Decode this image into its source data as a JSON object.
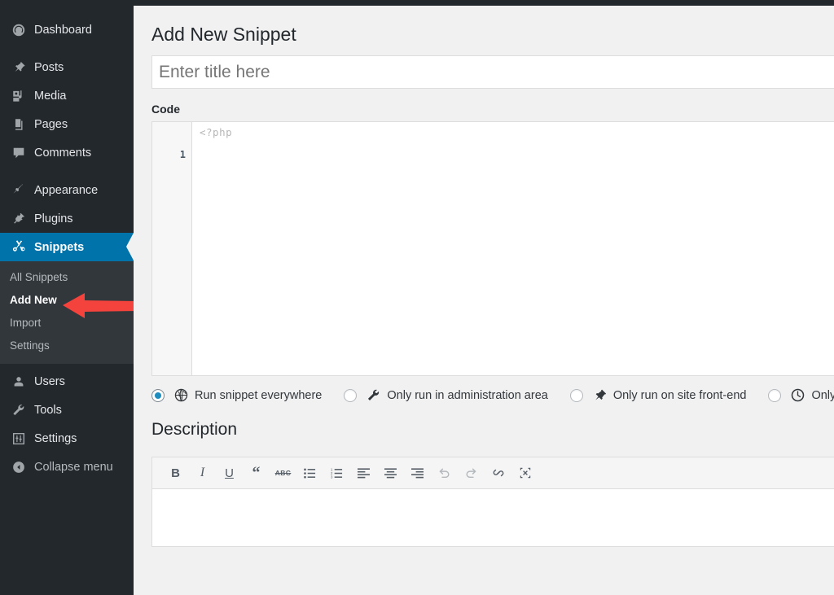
{
  "sidebar": {
    "items": [
      {
        "label": "Dashboard",
        "icon": "dashboard-icon"
      },
      {
        "label": "Posts",
        "icon": "pin-icon"
      },
      {
        "label": "Media",
        "icon": "media-icon"
      },
      {
        "label": "Pages",
        "icon": "pages-icon"
      },
      {
        "label": "Comments",
        "icon": "comment-icon"
      },
      {
        "label": "Appearance",
        "icon": "brush-icon"
      },
      {
        "label": "Plugins",
        "icon": "plug-icon"
      },
      {
        "label": "Snippets",
        "icon": "scissors-icon",
        "active": true
      },
      {
        "label": "Users",
        "icon": "user-icon"
      },
      {
        "label": "Tools",
        "icon": "wrench-icon"
      },
      {
        "label": "Settings",
        "icon": "sliders-icon"
      },
      {
        "label": "Collapse menu",
        "icon": "collapse-arrow-icon"
      }
    ],
    "submenu": [
      {
        "label": "All Snippets",
        "current": false
      },
      {
        "label": "Add New",
        "current": true
      },
      {
        "label": "Import",
        "current": false
      },
      {
        "label": "Settings",
        "current": false
      }
    ],
    "active_color": "#0073aa",
    "background_color": "#23282d",
    "submenu_background_color": "#32373c"
  },
  "annotation": {
    "arrow_color": "#f3433c",
    "points_at": "Add New"
  },
  "main": {
    "page_title": "Add New Snippet",
    "title_input": {
      "value": "",
      "placeholder": "Enter title here"
    },
    "code_section_label": "Code",
    "code_editor": {
      "line_number": "1",
      "content": "<?php"
    },
    "scope_options": [
      {
        "label": "Run snippet everywhere",
        "icon": "globe-icon",
        "selected": true
      },
      {
        "label": "Only run in administration area",
        "icon": "wrench-icon",
        "selected": false
      },
      {
        "label": "Only run on site front-end",
        "icon": "pin-icon",
        "selected": false
      },
      {
        "label": "Only run once",
        "icon": "clock-icon",
        "selected": false
      }
    ],
    "description_label": "Description",
    "editor_toolbar": [
      {
        "name": "bold-icon",
        "label": "B"
      },
      {
        "name": "italic-icon",
        "label": "I"
      },
      {
        "name": "underline-icon",
        "label": "U"
      },
      {
        "name": "blockquote-icon",
        "label": "“"
      },
      {
        "name": "strikethrough-icon",
        "label": "ABC"
      },
      {
        "name": "bulleted-list-icon",
        "label": ""
      },
      {
        "name": "numbered-list-icon",
        "label": ""
      },
      {
        "name": "align-left-icon",
        "label": ""
      },
      {
        "name": "align-center-icon",
        "label": ""
      },
      {
        "name": "align-right-icon",
        "label": ""
      },
      {
        "name": "undo-icon",
        "label": ""
      },
      {
        "name": "redo-icon",
        "label": ""
      },
      {
        "name": "link-icon",
        "label": ""
      },
      {
        "name": "fullscreen-icon",
        "label": ""
      }
    ],
    "description_value": ""
  }
}
